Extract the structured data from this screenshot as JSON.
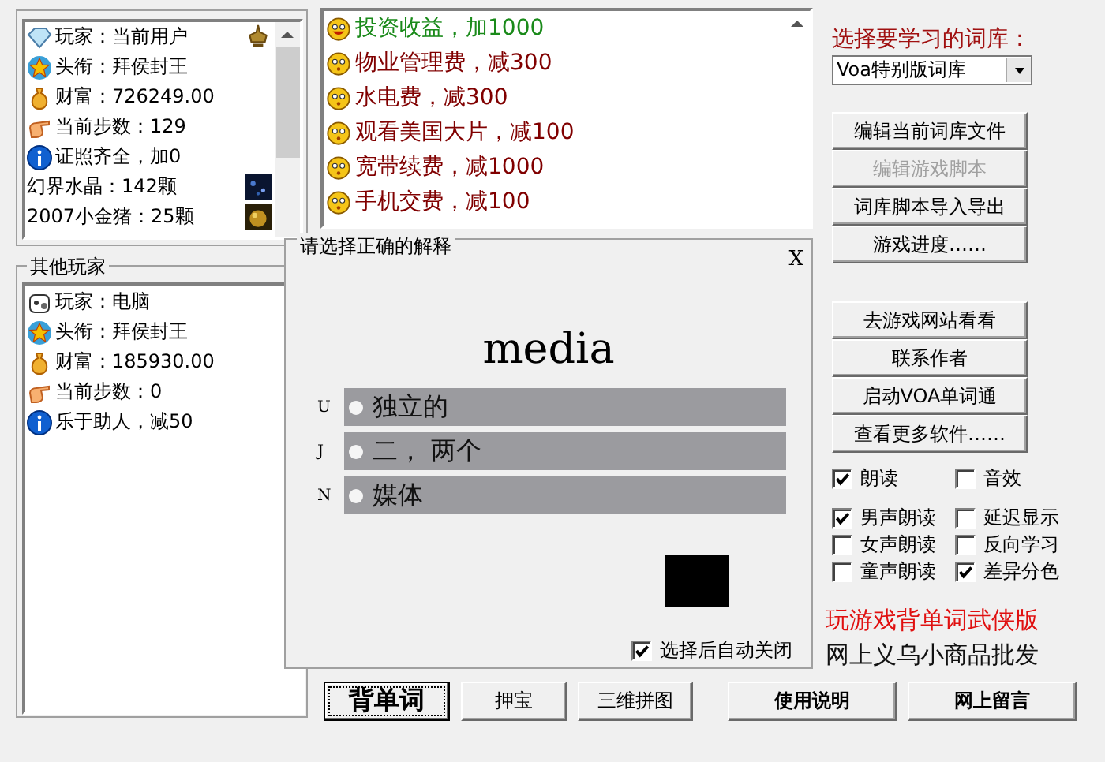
{
  "player": {
    "items": [
      {
        "kind": "player",
        "text": "玩家：当前用户",
        "thumbnail": {
          "kind": "lamp"
        }
      },
      {
        "kind": "title",
        "text": "头衔：拜侯封王"
      },
      {
        "kind": "wealth",
        "text": "财富：726249.00"
      },
      {
        "kind": "steps",
        "text": "当前步数：129"
      },
      {
        "kind": "info",
        "text": "证照齐全，加0"
      },
      {
        "kind": "plain",
        "text": "幻界水晶：142颗",
        "thumbnail": {
          "kind": "crystal"
        }
      },
      {
        "kind": "plain",
        "text": "2007小金猪：25颗",
        "thumbnail": {
          "kind": "pig"
        }
      }
    ]
  },
  "other_player": {
    "title": "其他玩家",
    "items": [
      {
        "kind": "computer",
        "text": "玩家：电脑"
      },
      {
        "kind": "title",
        "text": "头衔：拜侯封王"
      },
      {
        "kind": "wealth",
        "text": "财富：185930.00"
      },
      {
        "kind": "steps",
        "text": "当前步数：0"
      },
      {
        "kind": "info",
        "text": "乐于助人，减50"
      }
    ]
  },
  "events": [
    {
      "kind": "gain",
      "text": "投资收益，加1000"
    },
    {
      "kind": "loss",
      "text": "物业管理费，减300"
    },
    {
      "kind": "loss",
      "text": "水电费，减300"
    },
    {
      "kind": "loss",
      "text": "观看美国大片，减100"
    },
    {
      "kind": "loss",
      "text": "宽带续费，减1000"
    },
    {
      "kind": "loss",
      "text": "手机交费，减100"
    }
  ],
  "quiz": {
    "title": "请选择正确的解释",
    "close": "X",
    "word": "media",
    "options": [
      {
        "key": "U",
        "text": "独立的",
        "selected": false
      },
      {
        "key": "J",
        "text": "二， 两个",
        "selected": false
      },
      {
        "key": "N",
        "text": "媒体",
        "selected": false
      }
    ],
    "auto_close": {
      "label": "选择后自动关闭",
      "checked": true
    }
  },
  "library": {
    "label": "选择要学习的词库：",
    "value": "Voa特别版词库"
  },
  "tool_buttons": [
    {
      "label": "编辑当前词库文件",
      "disabled": false
    },
    {
      "label": "编辑游戏脚本",
      "disabled": true
    },
    {
      "label": "词库脚本导入导出",
      "disabled": false
    },
    {
      "label": "游戏进度……",
      "disabled": false
    }
  ],
  "link_buttons": [
    {
      "label": "去游戏网站看看",
      "disabled": false
    },
    {
      "label": "联系作者",
      "disabled": false
    },
    {
      "label": "启动VOA单词通",
      "disabled": false
    },
    {
      "label": "查看更多软件……",
      "disabled": false
    }
  ],
  "settings": [
    {
      "label": "朗读",
      "checked": true
    },
    {
      "label": "音效",
      "checked": false
    },
    {
      "label": "男声朗读",
      "checked": true
    },
    {
      "label": "延迟显示",
      "checked": false
    },
    {
      "label": "女声朗读",
      "checked": false
    },
    {
      "label": "反向学习",
      "checked": false
    },
    {
      "label": "童声朗读",
      "checked": false
    },
    {
      "label": "差异分色",
      "checked": true
    }
  ],
  "promos": [
    {
      "kind": "highlight",
      "text": "玩游戏背单词武侠版"
    },
    {
      "kind": "plain",
      "text": "网上义乌小商品批发"
    }
  ],
  "bottom_buttons": [
    {
      "kind": "large",
      "label": "背单词",
      "focused": true
    },
    {
      "kind": "normal",
      "label": "押宝",
      "focused": false
    },
    {
      "kind": "normal",
      "label": "三维拼图",
      "focused": false
    },
    {
      "kind": "bold",
      "label": "使用说明",
      "focused": false
    },
    {
      "kind": "bold",
      "label": "网上留言",
      "focused": false
    }
  ]
}
